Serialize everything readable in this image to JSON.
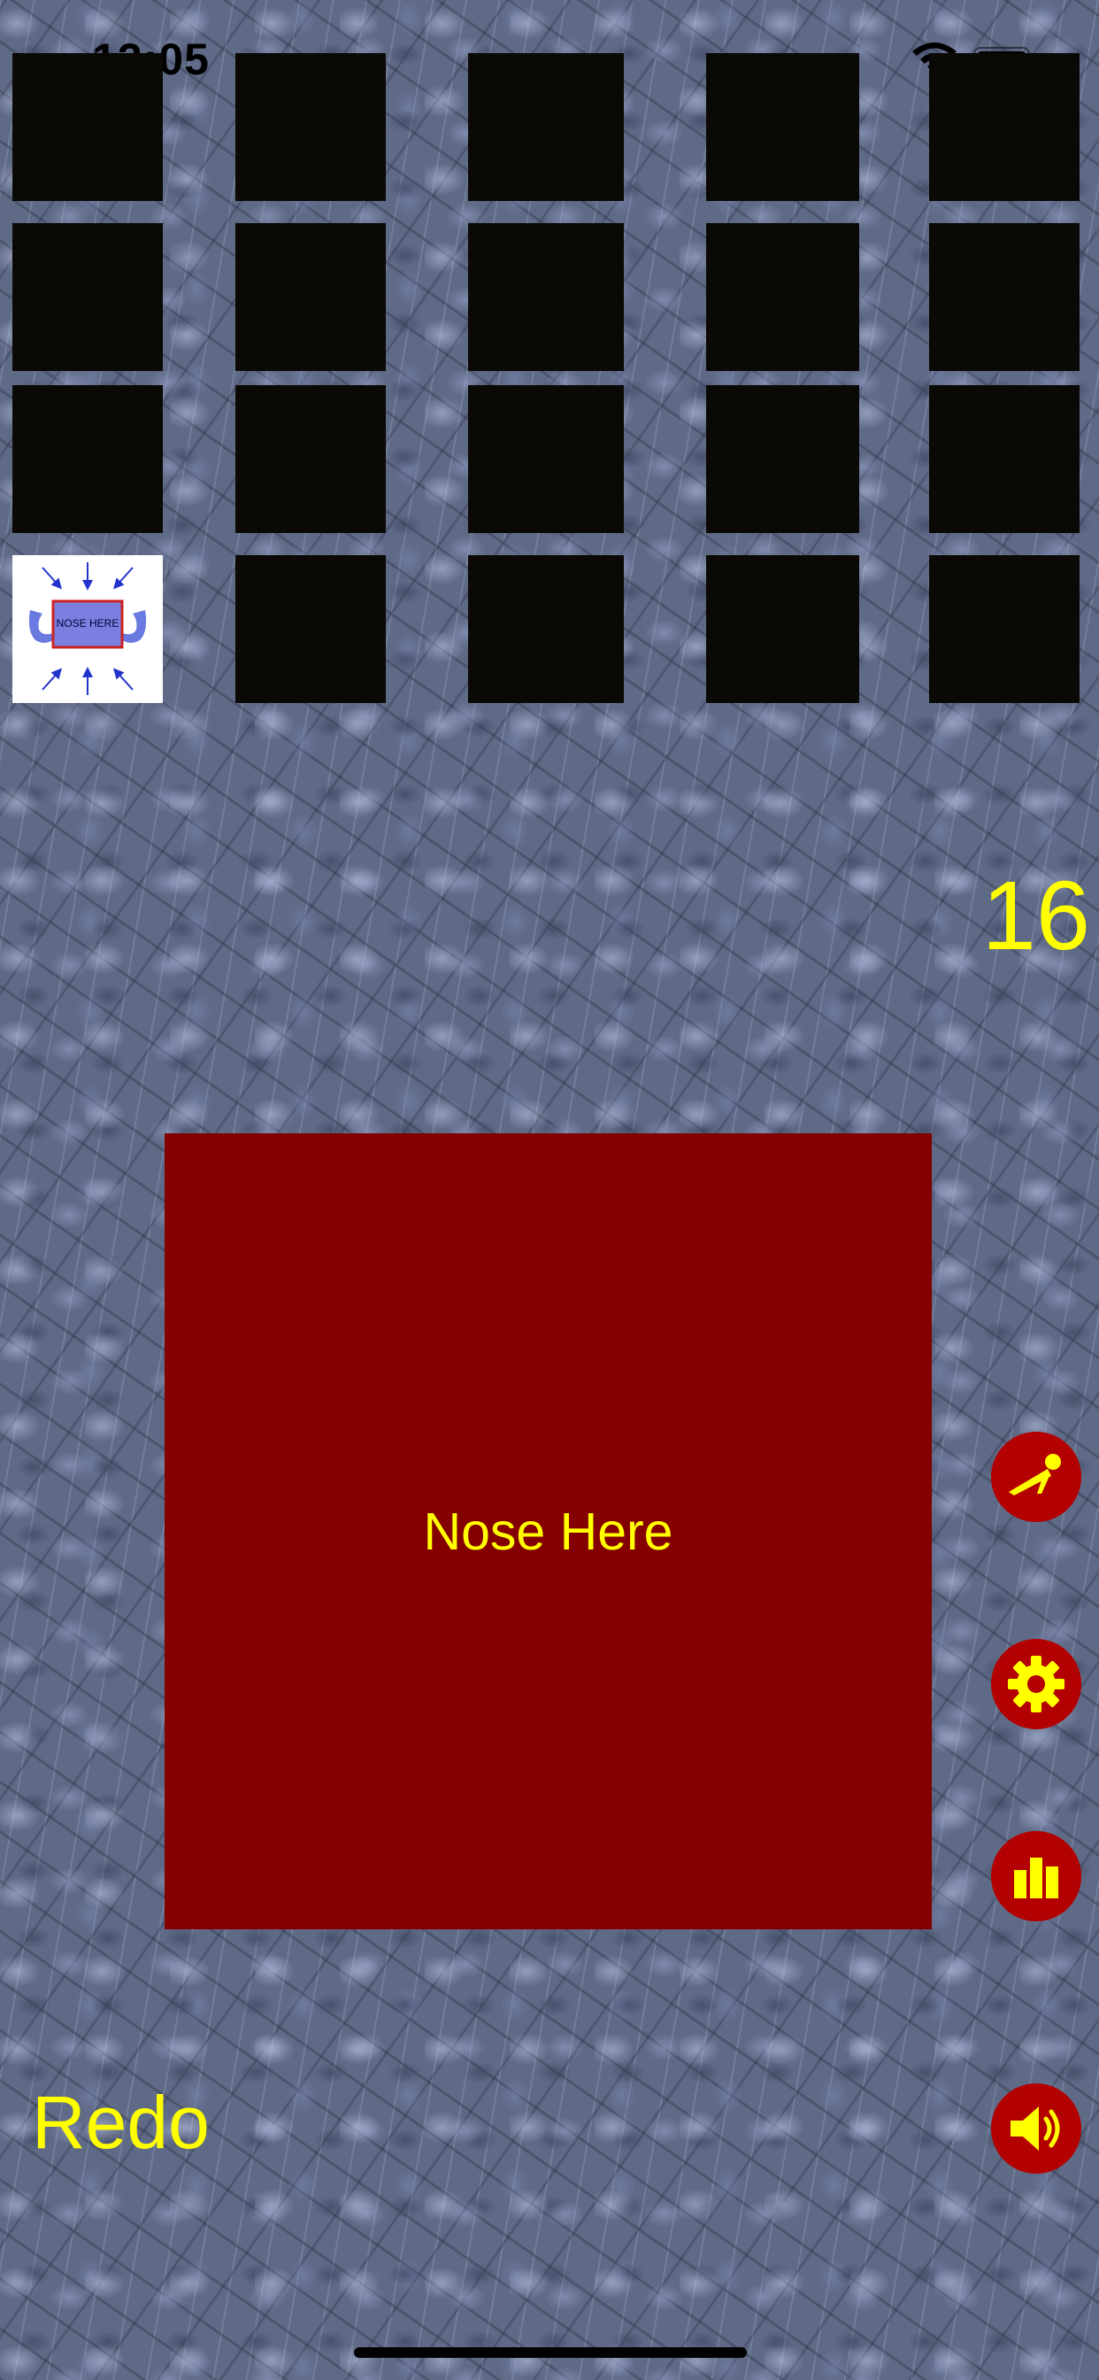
{
  "status_bar": {
    "time": "12:05",
    "wifi_icon": "wifi-icon",
    "battery_icon": "battery-icon"
  },
  "grid": {
    "rows": 4,
    "columns": 5,
    "tile_color": "#0b0905",
    "revealed_tile": {
      "label": "NOSE HERE",
      "icon": "nose-here-target-icon"
    }
  },
  "score": "16",
  "nose_area": {
    "label": "Nose Here",
    "color": "#840000"
  },
  "side_buttons": [
    {
      "name": "pushup-button",
      "icon": "pushup-figure-icon"
    },
    {
      "name": "settings-button",
      "icon": "gear-icon"
    },
    {
      "name": "stats-button",
      "icon": "bar-chart-icon"
    },
    {
      "name": "sound-button",
      "icon": "speaker-icon"
    }
  ],
  "redo_label": "Redo",
  "colors": {
    "accent_text": "#ffff00",
    "button_red": "#b30000"
  }
}
